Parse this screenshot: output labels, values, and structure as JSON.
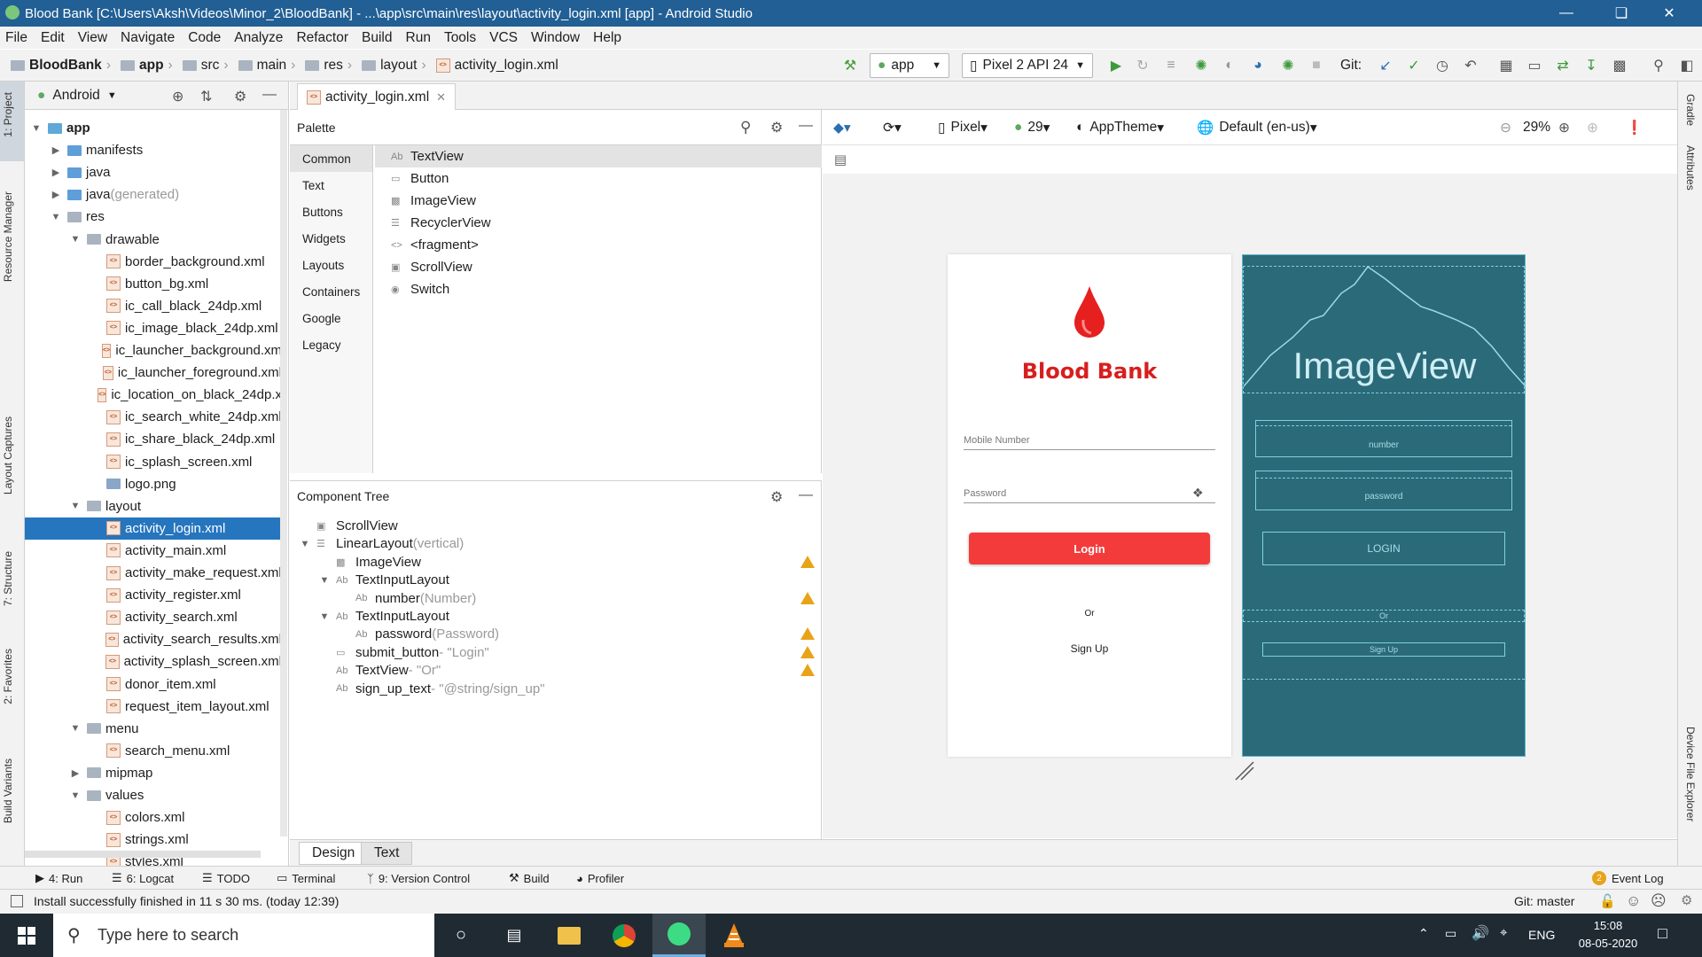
{
  "window": {
    "title": "Blood Bank [C:\\Users\\Aksh\\Videos\\Minor_2\\BloodBank] - ...\\app\\src\\main\\res\\layout\\activity_login.xml [app] - Android Studio"
  },
  "menu": [
    "File",
    "Edit",
    "View",
    "Navigate",
    "Code",
    "Analyze",
    "Refactor",
    "Build",
    "Run",
    "Tools",
    "VCS",
    "Window",
    "Help"
  ],
  "breadcrumbs": [
    "BloodBank",
    "app",
    "src",
    "main",
    "res",
    "layout",
    "activity_login.xml"
  ],
  "toolbar": {
    "run_config": "app",
    "device": "Pixel 2 API 24",
    "git_label": "Git:"
  },
  "left_tabs": [
    "1: Project",
    "Resource Manager",
    "Layout Captures",
    "7: Structure",
    "2: Favorites",
    "Build Variants"
  ],
  "right_tabs": [
    "Gradle",
    "Attributes",
    "Device File Explorer"
  ],
  "project": {
    "view": "Android",
    "tree": [
      {
        "label": "app",
        "level": 0,
        "kind": "module",
        "open": true
      },
      {
        "label": "manifests",
        "level": 1,
        "kind": "folder",
        "open": false
      },
      {
        "label": "java",
        "level": 1,
        "kind": "folder",
        "open": false
      },
      {
        "label": "java",
        "suffix": " (generated)",
        "level": 1,
        "kind": "folder",
        "open": false
      },
      {
        "label": "res",
        "level": 1,
        "kind": "folder",
        "open": true
      },
      {
        "label": "drawable",
        "level": 2,
        "kind": "folder",
        "open": true
      },
      {
        "label": "border_background.xml",
        "level": 3,
        "kind": "xml"
      },
      {
        "label": "button_bg.xml",
        "level": 3,
        "kind": "xml"
      },
      {
        "label": "ic_call_black_24dp.xml",
        "level": 3,
        "kind": "xml"
      },
      {
        "label": "ic_image_black_24dp.xml",
        "level": 3,
        "kind": "xml"
      },
      {
        "label": "ic_launcher_background.xm",
        "level": 3,
        "kind": "xml"
      },
      {
        "label": "ic_launcher_foreground.xml",
        "level": 3,
        "kind": "xml"
      },
      {
        "label": "ic_location_on_black_24dp.x",
        "level": 3,
        "kind": "xml"
      },
      {
        "label": "ic_search_white_24dp.xml",
        "level": 3,
        "kind": "xml"
      },
      {
        "label": "ic_share_black_24dp.xml",
        "level": 3,
        "kind": "xml"
      },
      {
        "label": "ic_splash_screen.xml",
        "level": 3,
        "kind": "xml"
      },
      {
        "label": "logo.png",
        "level": 3,
        "kind": "png"
      },
      {
        "label": "layout",
        "level": 2,
        "kind": "folder",
        "open": true
      },
      {
        "label": "activity_login.xml",
        "level": 3,
        "kind": "xml",
        "selected": true
      },
      {
        "label": "activity_main.xml",
        "level": 3,
        "kind": "xml"
      },
      {
        "label": "activity_make_request.xml",
        "level": 3,
        "kind": "xml"
      },
      {
        "label": "activity_register.xml",
        "level": 3,
        "kind": "xml"
      },
      {
        "label": "activity_search.xml",
        "level": 3,
        "kind": "xml"
      },
      {
        "label": "activity_search_results.xml",
        "level": 3,
        "kind": "xml"
      },
      {
        "label": "activity_splash_screen.xml",
        "level": 3,
        "kind": "xml"
      },
      {
        "label": "donor_item.xml",
        "level": 3,
        "kind": "xml"
      },
      {
        "label": "request_item_layout.xml",
        "level": 3,
        "kind": "xml"
      },
      {
        "label": "menu",
        "level": 2,
        "kind": "folder",
        "open": true
      },
      {
        "label": "search_menu.xml",
        "level": 3,
        "kind": "xml"
      },
      {
        "label": "mipmap",
        "level": 2,
        "kind": "folder",
        "open": false
      },
      {
        "label": "values",
        "level": 2,
        "kind": "folder",
        "open": true
      },
      {
        "label": "colors.xml",
        "level": 3,
        "kind": "xml"
      },
      {
        "label": "strings.xml",
        "level": 3,
        "kind": "xml"
      },
      {
        "label": "styles.xml",
        "level": 3,
        "kind": "xml"
      }
    ]
  },
  "editor_tab": "activity_login.xml",
  "palette": {
    "title": "Palette",
    "categories": [
      "Common",
      "Text",
      "Buttons",
      "Widgets",
      "Layouts",
      "Containers",
      "Google",
      "Legacy"
    ],
    "items": [
      "TextView",
      "Button",
      "ImageView",
      "RecyclerView",
      "<fragment>",
      "ScrollView",
      "Switch"
    ]
  },
  "component_tree": {
    "title": "Component Tree",
    "rows": [
      {
        "label": "ScrollView",
        "detail": "",
        "level": 0,
        "warn": false
      },
      {
        "label": "LinearLayout",
        "detail": "(vertical)",
        "level": 0,
        "warn": false,
        "expander": true
      },
      {
        "label": "ImageView",
        "detail": "",
        "level": 1,
        "warn": true
      },
      {
        "label": "TextInputLayout",
        "detail": "",
        "level": 1,
        "warn": false,
        "expander": true
      },
      {
        "label": "number",
        "detail": "(Number)",
        "level": 2,
        "warn": true
      },
      {
        "label": "TextInputLayout",
        "detail": "",
        "level": 1,
        "warn": false,
        "expander": true
      },
      {
        "label": "password",
        "detail": "(Password)",
        "level": 2,
        "warn": true
      },
      {
        "label": "submit_button",
        "detail": "- \"Login\"",
        "level": 1,
        "warn": true
      },
      {
        "label": "TextView",
        "detail": "- \"Or\"",
        "level": 1,
        "warn": true
      },
      {
        "label": "sign_up_text",
        "detail": "- \"@string/sign_up\"",
        "level": 1,
        "warn": false
      }
    ]
  },
  "editor_toolbar": {
    "device": "Pixel",
    "api": "29",
    "theme": "AppTheme",
    "locale": "Default (en-us)",
    "zoom": "29%"
  },
  "preview": {
    "app_name": "Blood Bank",
    "mobile_hint": "Mobile Number",
    "password_hint": "Password",
    "login_button": "Login",
    "or_text": "Or",
    "signup_text": "Sign Up",
    "accent": "#f43b3b"
  },
  "blueprint": {
    "image_label": "ImageView",
    "number": "number",
    "password": "password",
    "login": "LOGIN",
    "or": "Or",
    "signup": "Sign Up"
  },
  "design_tabs": [
    "Design",
    "Text"
  ],
  "tool_windows": [
    "4: Run",
    "6: Logcat",
    "TODO",
    "Terminal",
    "9: Version Control",
    "Build",
    "Profiler"
  ],
  "event_log": {
    "count": "2",
    "label": "Event Log"
  },
  "status": {
    "message": "Install successfully finished in 11 s 30 ms. (today 12:39)",
    "git": "Git: master"
  },
  "taskbar": {
    "search_placeholder": "Type here to search",
    "lang": "ENG",
    "time": "15:08",
    "date": "08-05-2020"
  },
  "colors": {
    "titlebar": "#215f95",
    "selection": "#2675bf",
    "blueprint": "#2b6a79",
    "warning": "#e8a317"
  }
}
